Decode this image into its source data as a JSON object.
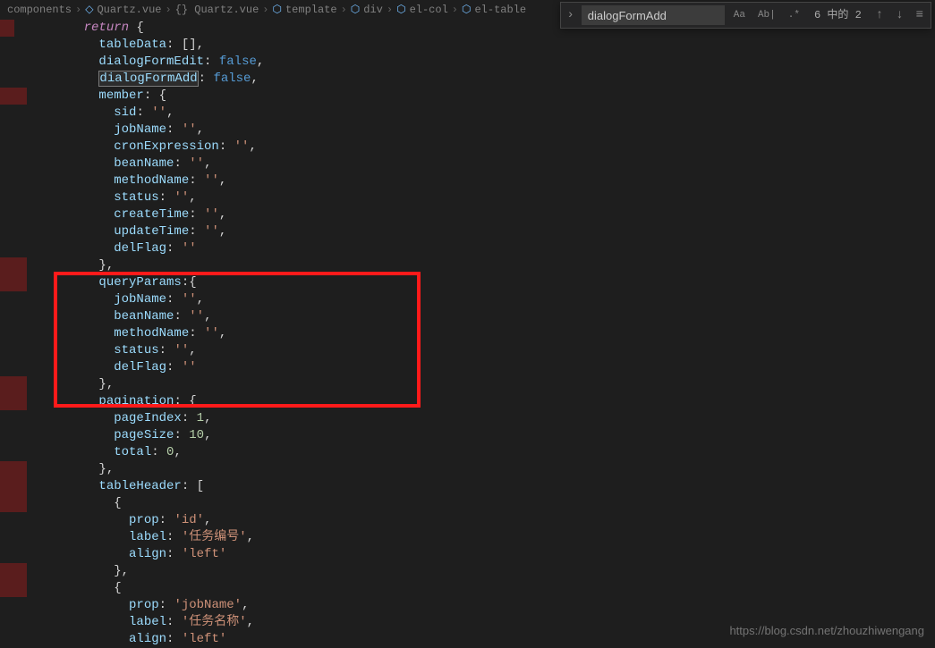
{
  "breadcrumb": {
    "items": [
      "components",
      "Quartz.vue",
      "{} Quartz.vue",
      "template",
      "div",
      "el-col",
      "el-table"
    ],
    "sep": "›"
  },
  "find": {
    "value": "dialogFormAdd",
    "result": "6 中的 2",
    "case_icon": "Aa",
    "word_icon": "Ab|",
    "regex_icon": ".*",
    "prev_icon": "↑",
    "next_icon": "↓",
    "menu_icon": "≡",
    "toggle_icon": "›"
  },
  "code": {
    "lines": [
      {
        "t": "return",
        "rest": " {"
      },
      {
        "prop": "tableData",
        "val": "[],"
      },
      {
        "prop": "dialogFormEdit",
        "val_k": "false",
        "tail": ","
      },
      {
        "prop": "dialogFormAdd",
        "val_k": "false",
        "tail": ",",
        "boxed": true
      },
      {
        "prop": "member",
        "val": "{"
      },
      {
        "sub": "sid",
        "str": "''",
        "tail": ","
      },
      {
        "sub": "jobName",
        "str": "''",
        "tail": ","
      },
      {
        "sub": "cronExpression",
        "str": "''",
        "tail": ","
      },
      {
        "sub": "beanName",
        "str": "''",
        "tail": ","
      },
      {
        "sub": "methodName",
        "str": "''",
        "tail": ","
      },
      {
        "sub": "status",
        "str": "''",
        "tail": ","
      },
      {
        "sub": "createTime",
        "str": "''",
        "tail": ","
      },
      {
        "sub": "updateTime",
        "str": "''",
        "tail": ","
      },
      {
        "sub": "delFlag",
        "str": "''"
      },
      {
        "close": "},"
      },
      {
        "prop": "queryParams",
        "val": "{"
      },
      {
        "sub": "jobName",
        "str": "''",
        "tail": ","
      },
      {
        "sub": "beanName",
        "str": "''",
        "tail": ","
      },
      {
        "sub": "methodName",
        "str": "''",
        "tail": ","
      },
      {
        "sub": "status",
        "str": "''",
        "tail": ","
      },
      {
        "sub": "delFlag",
        "str": "''"
      },
      {
        "close": "},"
      },
      {
        "prop": "pagination",
        "val": "{"
      },
      {
        "sub": "pageIndex",
        "num": "1",
        "tail": ","
      },
      {
        "sub": "pageSize",
        "num": "10",
        "tail": ","
      },
      {
        "sub": "total",
        "num": "0",
        "tail": ","
      },
      {
        "close": "},"
      },
      {
        "prop": "tableHeader",
        "val": "["
      },
      {
        "open": "{"
      },
      {
        "sub2": "prop",
        "str": "'id'",
        "tail": ","
      },
      {
        "sub2": "label",
        "str": "'任务编号'",
        "tail": ","
      },
      {
        "sub2": "align",
        "str": "'left'"
      },
      {
        "close2": "},"
      },
      {
        "open": "{"
      },
      {
        "sub2": "prop",
        "str": "'jobName'",
        "tail": ","
      },
      {
        "sub2": "label",
        "str": "'任务名称'",
        "tail": ","
      },
      {
        "sub2": "align",
        "str": "'left'"
      }
    ]
  },
  "watermark": "https://blog.csdn.net/zhouzhiwengang",
  "chart_data": {
    "type": "table",
    "title": "Vue component data() return object",
    "fields": {
      "tableData": [],
      "dialogFormEdit": false,
      "dialogFormAdd": false,
      "member": {
        "sid": "",
        "jobName": "",
        "cronExpression": "",
        "beanName": "",
        "methodName": "",
        "status": "",
        "createTime": "",
        "updateTime": "",
        "delFlag": ""
      },
      "queryParams": {
        "jobName": "",
        "beanName": "",
        "methodName": "",
        "status": "",
        "delFlag": ""
      },
      "pagination": {
        "pageIndex": 1,
        "pageSize": 10,
        "total": 0
      },
      "tableHeader": [
        {
          "prop": "id",
          "label": "任务编号",
          "align": "left"
        },
        {
          "prop": "jobName",
          "label": "任务名称",
          "align": "left"
        }
      ]
    }
  }
}
